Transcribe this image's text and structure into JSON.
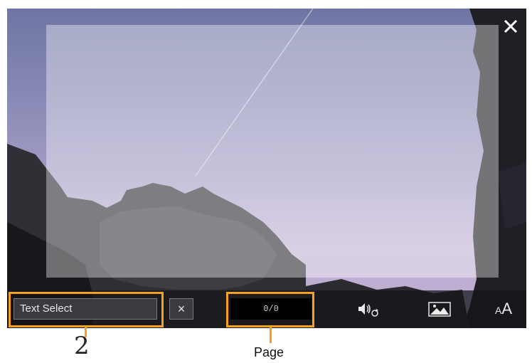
{
  "screen": {
    "close_icon": "close-icon"
  },
  "toolbar": {
    "text_select_label": "Text Select",
    "clear_label": "×",
    "page_indicator": "0/0",
    "icons": [
      "speaker-repeat-icon",
      "image-icon",
      "font-size-icon"
    ],
    "font_size_label_small": "A",
    "font_size_label_large": "A"
  },
  "annotations": {
    "callout_number": "2",
    "page_label": "Page",
    "callout_color": "#f4a21c"
  }
}
